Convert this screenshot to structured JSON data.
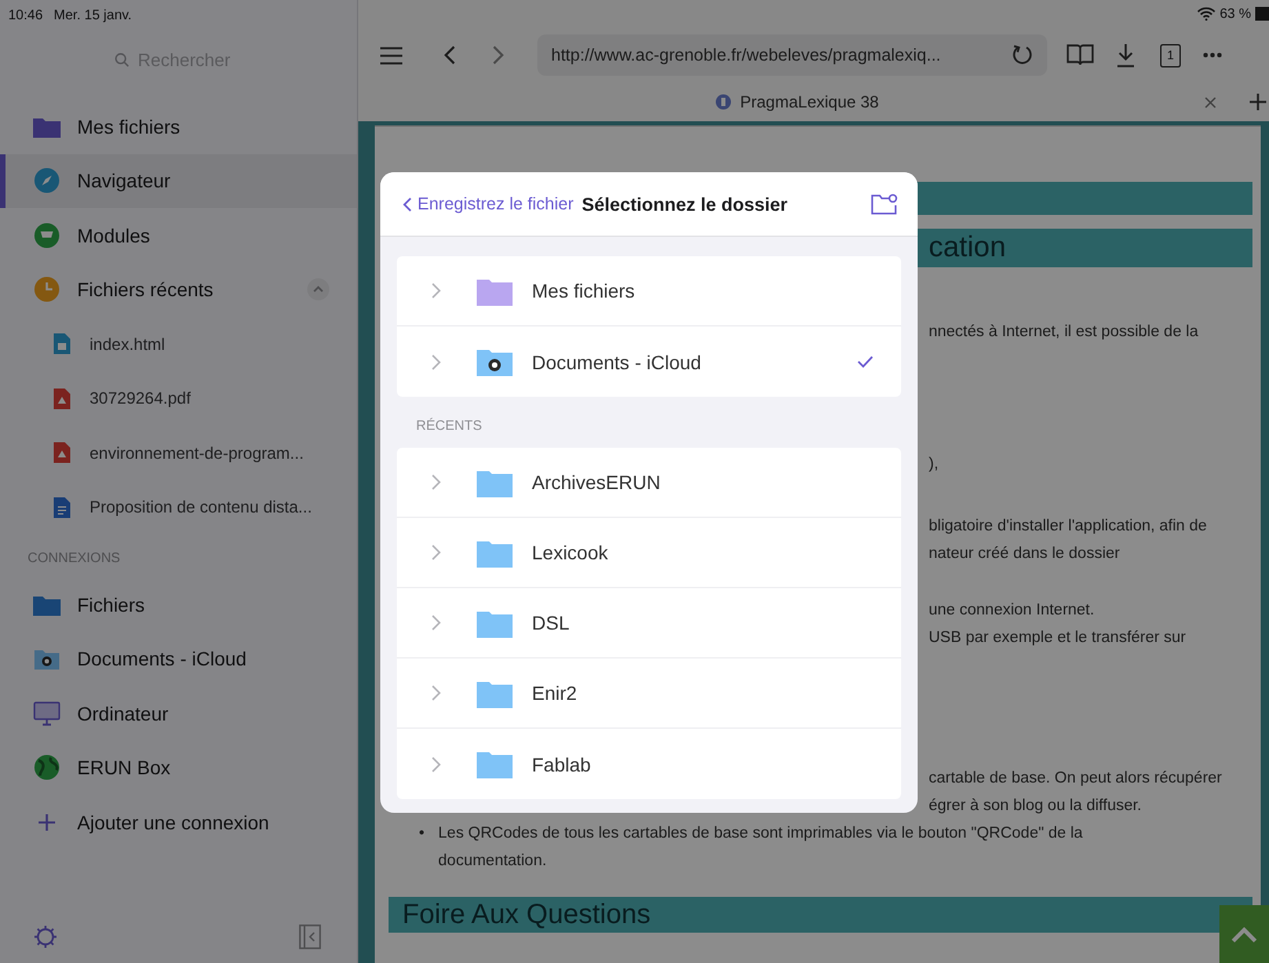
{
  "status_bar": {
    "time": "10:46",
    "date": "Mer. 15 janv.",
    "battery": "63 %"
  },
  "sidebar": {
    "search": {
      "placeholder": "Rechercher"
    },
    "items": [
      {
        "label": "Mes fichiers",
        "kind": "folder",
        "selected": false
      },
      {
        "label": "Navigateur",
        "kind": "compass",
        "selected": true
      },
      {
        "label": "Modules",
        "kind": "cart",
        "selected": false
      },
      {
        "label": "Fichiers récents",
        "kind": "clock",
        "selected": false,
        "expanded": true,
        "children": [
          {
            "label": "index.html",
            "kind": "html",
            "selected": false
          },
          {
            "label": "30729264.pdf",
            "kind": "pdf",
            "selected": false
          },
          {
            "label": "environnement-de-program...",
            "kind": "pdf",
            "selected": false
          },
          {
            "label": "Proposition de contenu dista...",
            "kind": "doc",
            "selected": false
          }
        ]
      }
    ],
    "section_label": "CONNEXIONS",
    "connections": [
      {
        "label": "Fichiers",
        "kind": "blue-folder",
        "selected": false
      },
      {
        "label": "Documents - iCloud",
        "kind": "cloud-folder",
        "selected": false
      },
      {
        "label": "Ordinateur",
        "kind": "monitor",
        "selected": false
      },
      {
        "label": "ERUN Box",
        "kind": "globe",
        "selected": false
      },
      {
        "label": "Ajouter une connexion",
        "kind": "add",
        "selected": false
      }
    ]
  },
  "browser": {
    "url": "http://www.ac-grenoble.fr/webeleves/pragmalexiq...",
    "tab_count": "1",
    "tabs": [
      {
        "title": "PragmaLexique 38",
        "selected": true
      }
    ],
    "page": {
      "heading_1": "cation",
      "lines_1": [
        "nnectés à Internet, il est possible de la"
      ],
      "lines_2": [
        "),"
      ],
      "lines_3": [
        "bligatoire d'installer l'application, afin de",
        "nateur créé dans le dossier"
      ],
      "lines_4": [
        "une connexion Internet.",
        "USB par exemple et le transférer sur"
      ],
      "lines_5": [
        "cartable de base. On peut alors récupérer",
        "égrer à son blog ou la diffuser."
      ],
      "bullets": [
        {
          "marker": "•",
          "text": "Les QRCodes de tous les cartables de base sont imprimables via le bouton \"QRCode\" de la documentation."
        }
      ],
      "heading_2": "Foire Aux Questions"
    }
  },
  "dialog": {
    "back": "Enregistrez le fichier",
    "title": "Sélectionnez le dossier",
    "locations": [
      {
        "name": "Mes fichiers",
        "kind": "purple-folder",
        "selected": false
      },
      {
        "name": "Documents - iCloud",
        "kind": "cloud-folder",
        "selected": true
      }
    ],
    "recents_label": "RÉCENTS",
    "recents": [
      {
        "name": "ArchivesERUN",
        "kind": "blue-folder",
        "selected": false
      },
      {
        "name": "Lexicook",
        "kind": "blue-folder",
        "selected": false
      },
      {
        "name": "DSL",
        "kind": "blue-folder",
        "selected": false
      },
      {
        "name": "Enir2",
        "kind": "blue-folder",
        "selected": false
      },
      {
        "name": "Fablab",
        "kind": "blue-folder",
        "selected": false
      }
    ]
  }
}
